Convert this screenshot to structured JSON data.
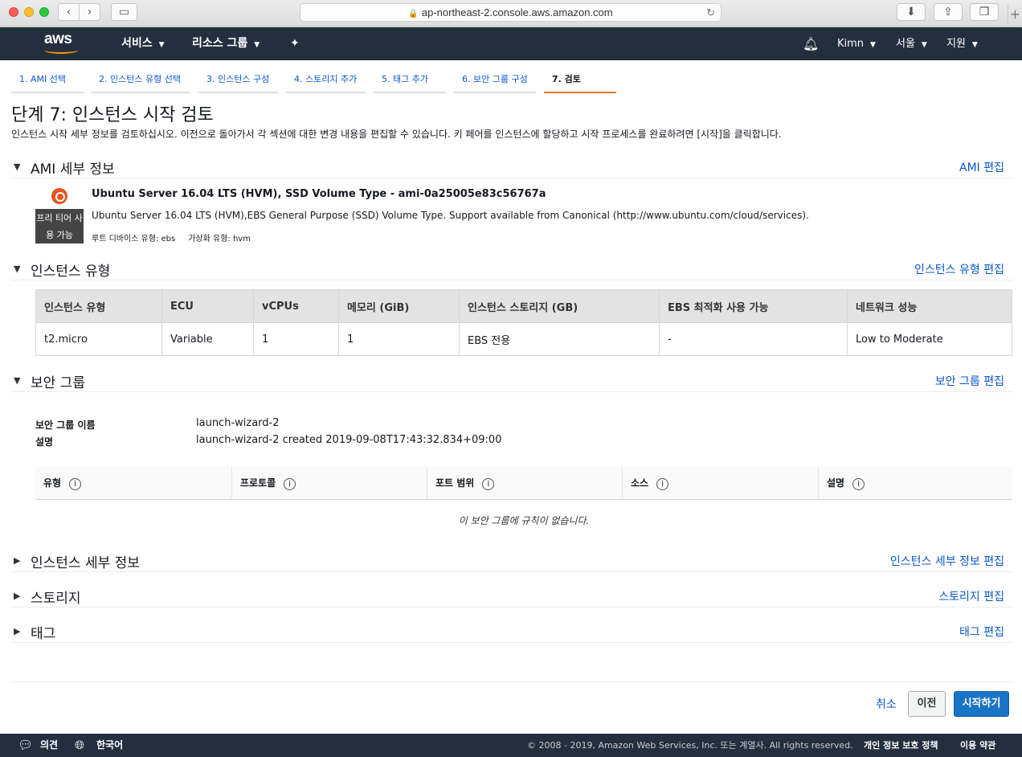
{
  "browser": {
    "url": "ap-northeast-2.console.aws.amazon.com"
  },
  "nav": {
    "logo": "aws",
    "services": "서비스",
    "resource_groups": "리소스 그룹",
    "user": "Kimn",
    "region": "서울",
    "support": "지원"
  },
  "steps": [
    "1. AMI 선택",
    "2. 인스턴스 유형 선택",
    "3. 인스턴스 구성",
    "4. 스토리지 추가",
    "5. 태그 추가",
    "6. 보안 그룹 구성",
    "7. 검토"
  ],
  "page": {
    "title": "단계 7: 인스턴스 시작 검토",
    "description": "인스턴스 시작 세부 정보를 검토하십시오. 이전으로 돌아가서 각 섹션에 대한 변경 내용을 편집할 수 있습니다. 키 페어를 인스턴스에 할당하고 시작 프로세스를 완료하려면 [시작]을 클릭합니다."
  },
  "ami": {
    "section_title": "AMI 세부 정보",
    "edit": "AMI 편집",
    "badge": "프리 티어 사용 가능",
    "name": "Ubuntu Server 16.04 LTS (HVM), SSD Volume Type - ami-0a25005e83c56767a",
    "description": "Ubuntu Server 16.04 LTS (HVM),EBS General Purpose (SSD) Volume Type. Support available from Canonical (http://www.ubuntu.com/cloud/services).",
    "root_device": "루트 디바이스 유형: ebs",
    "virtualization": "가상화 유형: hvm"
  },
  "instance_type": {
    "section_title": "인스턴스 유형",
    "edit": "인스턴스 유형 편집",
    "headers": [
      "인스턴스 유형",
      "ECU",
      "vCPUs",
      "메모리 (GiB)",
      "인스턴스 스토리지 (GB)",
      "EBS 최적화 사용 가능",
      "네트워크 성능"
    ],
    "row": [
      "t2.micro",
      "Variable",
      "1",
      "1",
      "EBS 전용",
      "-",
      "Low to Moderate"
    ]
  },
  "security_group": {
    "section_title": "보안 그룹",
    "edit": "보안 그룹 편집",
    "name_label": "보안 그룹 이름",
    "name_value": "launch-wizard-2",
    "desc_label": "설명",
    "desc_value": "launch-wizard-2 created 2019-09-08T17:43:32.834+09:00",
    "rule_headers": [
      "유형",
      "프로토콜",
      "포트 범위",
      "소스",
      "설명"
    ],
    "empty": "이 보안 그룹에 규칙이 없습니다."
  },
  "collapsed_sections": [
    {
      "title": "인스턴스 세부 정보",
      "edit": "인스턴스 세부 정보 편집"
    },
    {
      "title": "스토리지",
      "edit": "스토리지 편집"
    },
    {
      "title": "태그",
      "edit": "태그 편집"
    }
  ],
  "actions": {
    "cancel": "취소",
    "previous": "이전",
    "launch": "시작하기"
  },
  "footer": {
    "feedback": "의견",
    "language": "한국어",
    "copyright": "© 2008 - 2019, Amazon Web Services, Inc. 또는 계열사. All rights reserved.",
    "privacy": "개인 정보 보호 정책",
    "terms": "이용 약관"
  },
  "colors": {
    "nav_bg": "#232f3e",
    "link": "#0a58ca",
    "active_tab": "#ec7211",
    "primary_button": "#1a73c4",
    "ubuntu": "#e95420"
  }
}
